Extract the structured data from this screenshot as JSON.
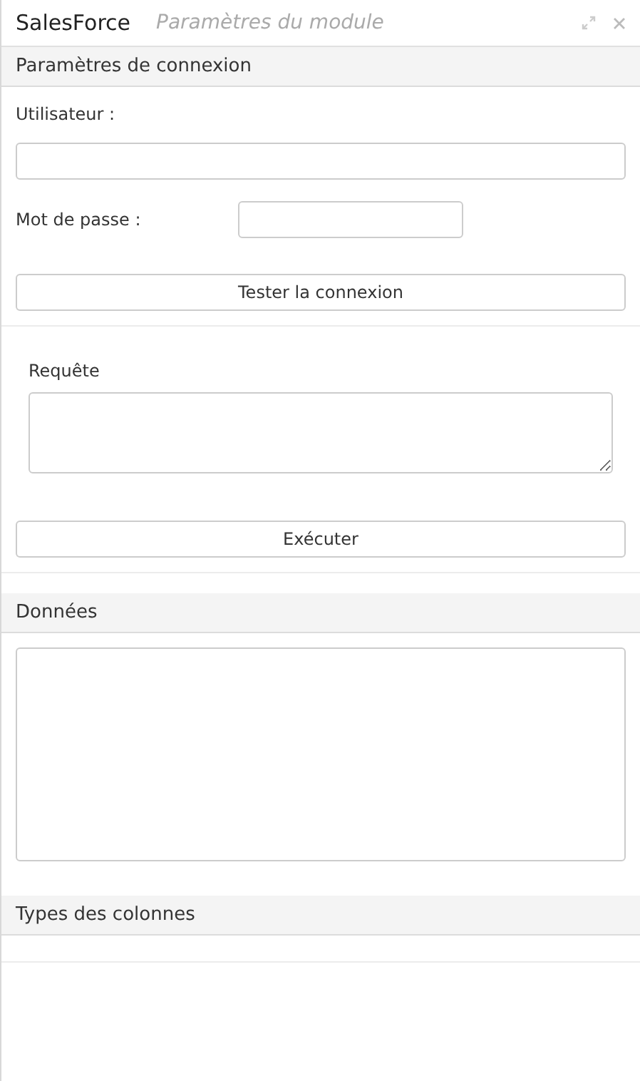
{
  "window": {
    "title": "SalesForce",
    "subtitle": "Paramètres du module"
  },
  "connection": {
    "header": "Paramètres de connexion",
    "user_label": "Utilisateur :",
    "password_label": "Mot de passe :",
    "test_button": "Tester la connexion"
  },
  "query": {
    "label": "Requête",
    "run_button": "Exécuter"
  },
  "data": {
    "header": "Données"
  },
  "column_types": {
    "header": "Types des colonnes"
  }
}
